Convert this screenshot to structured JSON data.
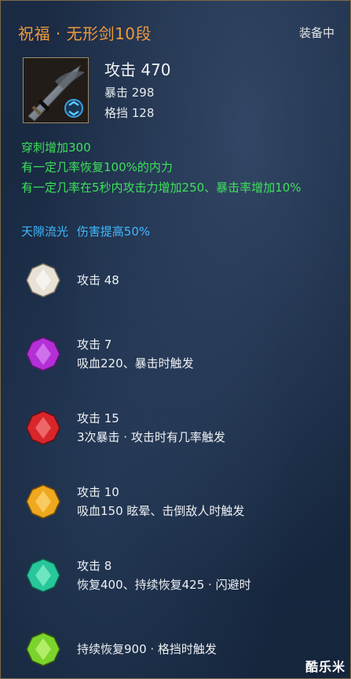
{
  "header": {
    "title": "祝福 · 无形剑10段",
    "status": "装备中"
  },
  "item": {
    "icon_name": "sword-weapon-icon",
    "main_stat": "攻击 470",
    "sub_stats": [
      "暴击 298",
      "格挡 128"
    ]
  },
  "effects": [
    "穿刺增加300",
    "有一定几率恢复100%的内力",
    "有一定几率在5秒内攻击力增加250、暴击率增加10%"
  ],
  "set_bonus": {
    "name": "天隙流光",
    "effect": "伤害提高50%"
  },
  "gems": [
    {
      "color": "#e8e2d6",
      "icon_name": "white-gem-icon",
      "lines": [
        "攻击 48"
      ]
    },
    {
      "color": "#b42fd6",
      "icon_name": "purple-gem-icon",
      "lines": [
        "攻击 7",
        "吸血220、暴击时触发"
      ]
    },
    {
      "color": "#d8262b",
      "icon_name": "red-gem-icon",
      "lines": [
        "攻击 15",
        "3次暴击 · 攻击时有几率触发"
      ]
    },
    {
      "color": "#f0a81f",
      "icon_name": "orange-gem-icon",
      "lines": [
        "攻击 10",
        "吸血150 眩晕、击倒敌人时触发"
      ]
    },
    {
      "color": "#27c79a",
      "icon_name": "teal-gem-icon",
      "lines": [
        "攻击 8",
        "恢复400、持续恢复425 · 闪避时"
      ]
    },
    {
      "color": "#7bd42c",
      "icon_name": "green-gem-icon",
      "lines": [
        "持续恢复900 · 格挡时触发"
      ]
    }
  ],
  "watermark": "酷乐米"
}
